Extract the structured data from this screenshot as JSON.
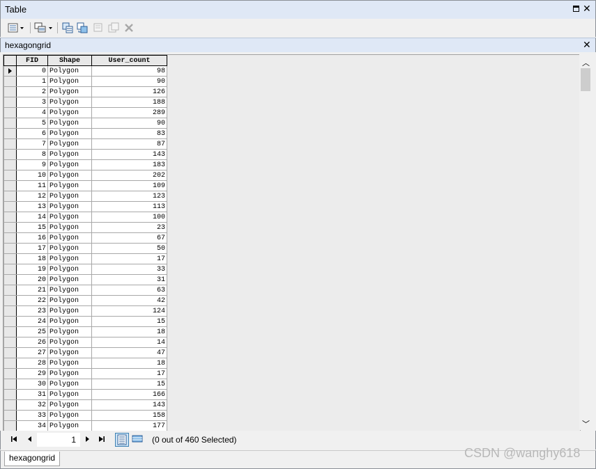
{
  "window": {
    "title": "Table"
  },
  "table_tab": {
    "name": "hexagongrid"
  },
  "columns": [
    "FID",
    "Shape",
    "User_count"
  ],
  "rows": [
    {
      "fid": "0",
      "shape": "Polygon",
      "user_count": "98"
    },
    {
      "fid": "1",
      "shape": "Polygon",
      "user_count": "90"
    },
    {
      "fid": "2",
      "shape": "Polygon",
      "user_count": "126"
    },
    {
      "fid": "3",
      "shape": "Polygon",
      "user_count": "188"
    },
    {
      "fid": "4",
      "shape": "Polygon",
      "user_count": "289"
    },
    {
      "fid": "5",
      "shape": "Polygon",
      "user_count": "90"
    },
    {
      "fid": "6",
      "shape": "Polygon",
      "user_count": "83"
    },
    {
      "fid": "7",
      "shape": "Polygon",
      "user_count": "87"
    },
    {
      "fid": "8",
      "shape": "Polygon",
      "user_count": "143"
    },
    {
      "fid": "9",
      "shape": "Polygon",
      "user_count": "183"
    },
    {
      "fid": "10",
      "shape": "Polygon",
      "user_count": "202"
    },
    {
      "fid": "11",
      "shape": "Polygon",
      "user_count": "109"
    },
    {
      "fid": "12",
      "shape": "Polygon",
      "user_count": "123"
    },
    {
      "fid": "13",
      "shape": "Polygon",
      "user_count": "113"
    },
    {
      "fid": "14",
      "shape": "Polygon",
      "user_count": "100"
    },
    {
      "fid": "15",
      "shape": "Polygon",
      "user_count": "23"
    },
    {
      "fid": "16",
      "shape": "Polygon",
      "user_count": "67"
    },
    {
      "fid": "17",
      "shape": "Polygon",
      "user_count": "50"
    },
    {
      "fid": "18",
      "shape": "Polygon",
      "user_count": "17"
    },
    {
      "fid": "19",
      "shape": "Polygon",
      "user_count": "33"
    },
    {
      "fid": "20",
      "shape": "Polygon",
      "user_count": "31"
    },
    {
      "fid": "21",
      "shape": "Polygon",
      "user_count": "63"
    },
    {
      "fid": "22",
      "shape": "Polygon",
      "user_count": "42"
    },
    {
      "fid": "23",
      "shape": "Polygon",
      "user_count": "124"
    },
    {
      "fid": "24",
      "shape": "Polygon",
      "user_count": "15"
    },
    {
      "fid": "25",
      "shape": "Polygon",
      "user_count": "18"
    },
    {
      "fid": "26",
      "shape": "Polygon",
      "user_count": "14"
    },
    {
      "fid": "27",
      "shape": "Polygon",
      "user_count": "47"
    },
    {
      "fid": "28",
      "shape": "Polygon",
      "user_count": "18"
    },
    {
      "fid": "29",
      "shape": "Polygon",
      "user_count": "17"
    },
    {
      "fid": "30",
      "shape": "Polygon",
      "user_count": "15"
    },
    {
      "fid": "31",
      "shape": "Polygon",
      "user_count": "166"
    },
    {
      "fid": "32",
      "shape": "Polygon",
      "user_count": "143"
    },
    {
      "fid": "33",
      "shape": "Polygon",
      "user_count": "158"
    },
    {
      "fid": "34",
      "shape": "Polygon",
      "user_count": "177"
    }
  ],
  "navigation": {
    "current_record": "1",
    "selection_text": "(0 out of 460 Selected)"
  },
  "bottom_tab": {
    "name": "hexagongrid"
  },
  "watermark": "CSDN @wanghy618",
  "icons": {
    "table_options": "table-options-icon",
    "related_tables": "related-tables-icon",
    "select_by_attributes": "select-by-attributes-icon",
    "switch_selection": "switch-selection-icon",
    "clear_selection": "clear-selection-icon",
    "zoom_to_selected": "zoom-to-selected-icon",
    "delete_selected": "delete-selected-icon"
  },
  "colors": {
    "title_bar": "#dfe8f6",
    "active_view": "#cce4f7"
  }
}
